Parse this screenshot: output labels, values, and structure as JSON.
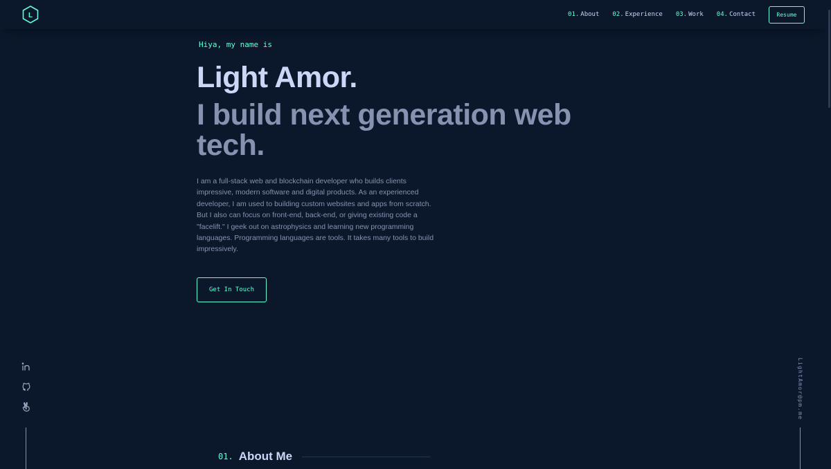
{
  "header": {
    "logo_letter": "L",
    "nav": [
      {
        "num": "01.",
        "label": "About"
      },
      {
        "num": "02.",
        "label": "Experience"
      },
      {
        "num": "03.",
        "label": "Work"
      },
      {
        "num": "04.",
        "label": "Contact"
      }
    ],
    "resume_label": "Resume"
  },
  "hero": {
    "greeting": "Hiya, my name is",
    "name": "Light Amor.",
    "tagline": "I build next generation web tech.",
    "bio": "I am a full-stack web and blockchain developer who builds clients impressive, modern software and digital products. As an experienced developer, I am used to building custom websites and apps from scratch. But I also can focus on front-end, back-end, or giving existing code a \"facelift.\" I geek out on astrophysics and learning new programming languages. Programming languages are tools. It takes many tools to build impressively.",
    "cta_label": "Get In Touch"
  },
  "social": {
    "icons": [
      "linkedin-icon",
      "github-icon",
      "angellist-icon"
    ]
  },
  "email": "LightAmor@pm.me",
  "about": {
    "num": "01.",
    "title": "About Me"
  },
  "colors": {
    "background": "#0b172b",
    "accent": "#64ffda",
    "heading": "#ccd6f6",
    "text": "#8892b0"
  }
}
